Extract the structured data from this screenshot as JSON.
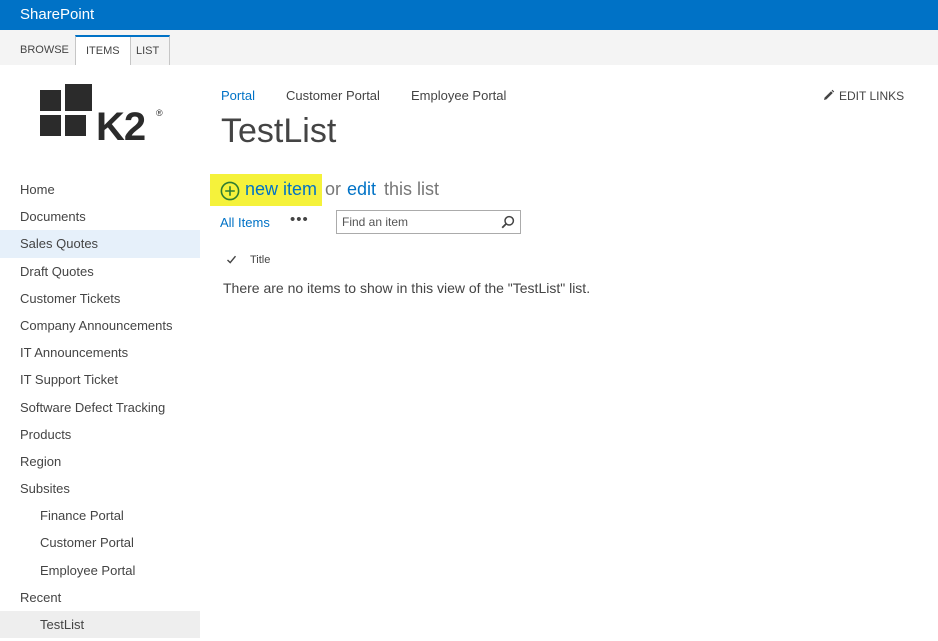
{
  "suitebar": {
    "brand": "SharePoint"
  },
  "ribbon": {
    "tabs": [
      {
        "label": "BROWSE"
      },
      {
        "label": "ITEMS"
      },
      {
        "label": "LIST"
      }
    ]
  },
  "logo": {
    "text": "K2",
    "reg": "®"
  },
  "quicklaunch": {
    "items": [
      {
        "label": "Home"
      },
      {
        "label": "Documents"
      },
      {
        "label": "Sales Quotes"
      },
      {
        "label": "Draft Quotes"
      },
      {
        "label": "Customer Tickets"
      },
      {
        "label": "Company Announcements"
      },
      {
        "label": "IT Announcements"
      },
      {
        "label": "IT Support Ticket"
      },
      {
        "label": "Software Defect Tracking"
      },
      {
        "label": "Products"
      },
      {
        "label": "Region"
      },
      {
        "label": "Subsites"
      },
      {
        "label": "Finance Portal"
      },
      {
        "label": "Customer Portal"
      },
      {
        "label": "Employee Portal"
      },
      {
        "label": "Recent"
      },
      {
        "label": "TestList"
      }
    ]
  },
  "topnav": {
    "links": [
      {
        "label": "Portal"
      },
      {
        "label": "Customer Portal"
      },
      {
        "label": "Employee Portal"
      }
    ]
  },
  "edit_links": {
    "label": "EDIT LINKS"
  },
  "page": {
    "title": "TestList"
  },
  "actions": {
    "new_item": "new item",
    "or": "or",
    "edit": "edit",
    "this_list": "this list"
  },
  "views": {
    "current": "All Items",
    "more": "•••"
  },
  "search": {
    "placeholder": "Find an item"
  },
  "list": {
    "columns": [
      {
        "label": "Title"
      }
    ],
    "empty_message": "There are no items to show in this view of the \"TestList\" list."
  },
  "colors": {
    "suitebar": "#0072c6",
    "link": "#0072c6",
    "highlight": "#f5f23b",
    "plus_icon": "#2e7d32"
  }
}
